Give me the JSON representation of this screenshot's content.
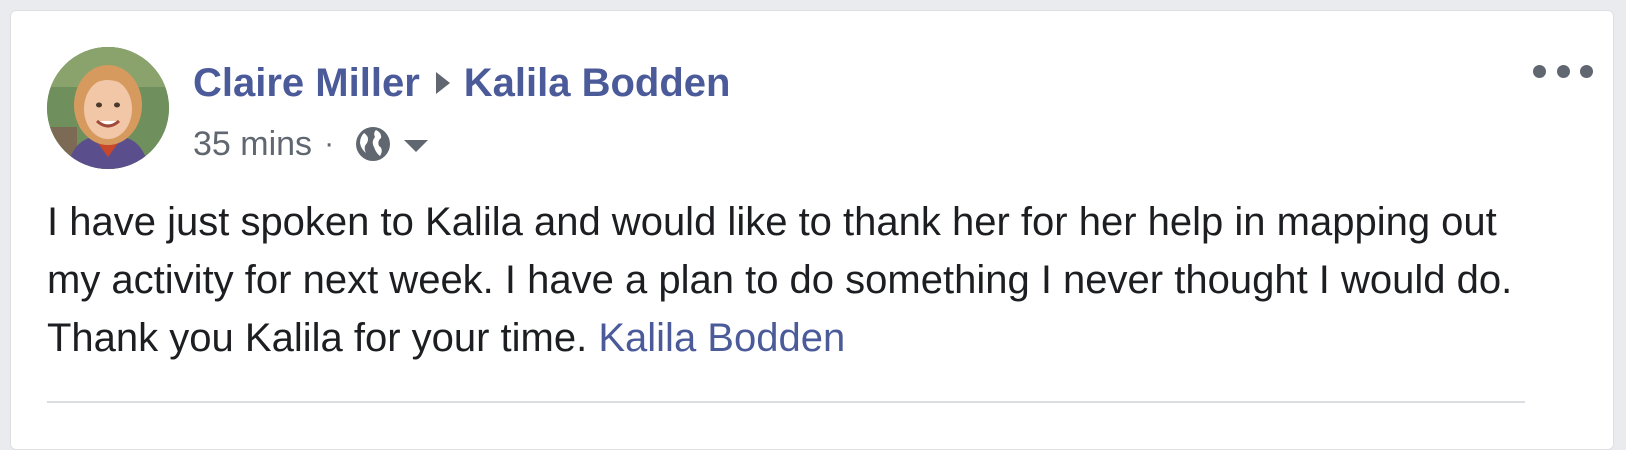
{
  "post": {
    "author": "Claire Miller",
    "recipient": "Kalila Bodden",
    "timestamp": "35 mins",
    "separator": "·",
    "privacy_icon": "globe-icon",
    "body_text": "I have just spoken to Kalila and would like to thank her for her help in mapping out my activity for next week. I have a plan to do something I never thought I would do. Thank you Kalila for your time. ",
    "mention": "Kalila Bodden",
    "more_icon": "more-options-icon"
  },
  "colors": {
    "link": "#4b5b9a",
    "text": "#1c1e21",
    "muted": "#606770",
    "background": "#e9ebee"
  }
}
